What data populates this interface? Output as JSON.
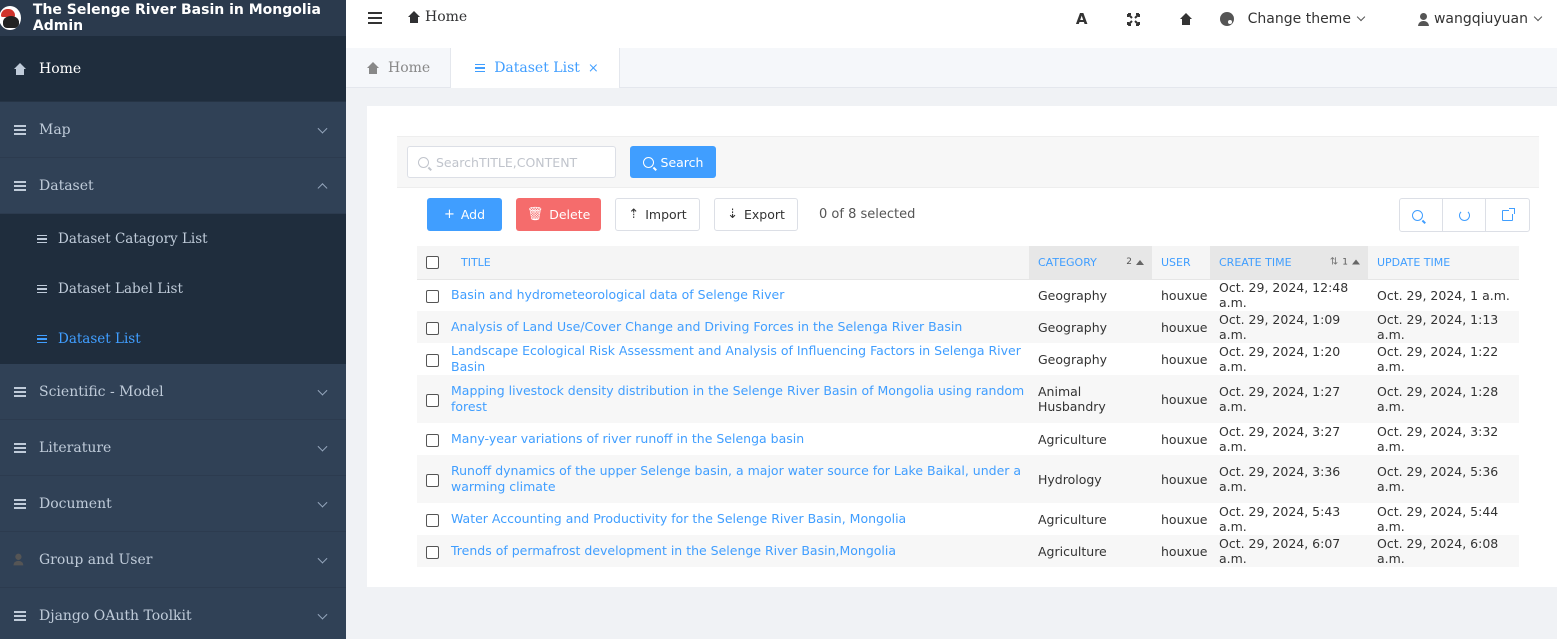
{
  "app": {
    "title": "The Selenge River Basin in Mongolia Admin"
  },
  "sidebar": {
    "items": [
      {
        "label": "Home"
      },
      {
        "label": "Map"
      },
      {
        "label": "Dataset"
      },
      {
        "label": "Scientific - Model"
      },
      {
        "label": "Literature"
      },
      {
        "label": "Document"
      },
      {
        "label": "Group and User"
      },
      {
        "label": "Django OAuth Toolkit"
      }
    ],
    "dataset_sub": [
      {
        "label": "Dataset Catagory List"
      },
      {
        "label": "Dataset Label List"
      },
      {
        "label": "Dataset List"
      }
    ]
  },
  "header": {
    "breadcrumb": "Home",
    "theme_label": "Change theme",
    "username": "wangqiuyuan",
    "font_glyph": "A"
  },
  "tabs": [
    {
      "label": "Home"
    },
    {
      "label": "Dataset List",
      "close": "×"
    }
  ],
  "search": {
    "placeholder": "SearchTITLE,CONTENT",
    "button": "Search"
  },
  "toolbar": {
    "add": "Add",
    "delete": "Delete",
    "import": "Import",
    "export": "Export",
    "selected": "0 of 8 selected"
  },
  "table": {
    "columns": [
      "TITLE",
      "CATEGORY",
      "USER",
      "CREATE TIME",
      "UPDATE TIME"
    ],
    "category_sort_rank": "2",
    "create_sort_rank": "1",
    "rows": [
      [
        "Basin and hydrometeorological data of Selenge River",
        "Geography",
        "houxue",
        "Oct. 29, 2024, 12:48 a.m.",
        "Oct. 29, 2024, 1 a.m."
      ],
      [
        "Analysis of Land Use/Cover Change and Driving Forces in the Selenga River Basin",
        "Geography",
        "houxue",
        "Oct. 29, 2024, 1:09 a.m.",
        "Oct. 29, 2024, 1:13 a.m."
      ],
      [
        "Landscape Ecological Risk Assessment and Analysis of Influencing Factors in Selenga River Basin",
        "Geography",
        "houxue",
        "Oct. 29, 2024, 1:20 a.m.",
        "Oct. 29, 2024, 1:22 a.m."
      ],
      [
        "Mapping livestock density distribution in the Selenge River Basin of Mongolia using random forest",
        "Animal Husbandry",
        "houxue",
        "Oct. 29, 2024, 1:27 a.m.",
        "Oct. 29, 2024, 1:28 a.m."
      ],
      [
        "Many-year variations of river runoff in the Selenga basin",
        "Agriculture",
        "houxue",
        "Oct. 29, 2024, 3:27 a.m.",
        "Oct. 29, 2024, 3:32 a.m."
      ],
      [
        "Runoff dynamics of the upper Selenge basin, a major water source for Lake Baikal, under a warming climate",
        "Hydrology",
        "houxue",
        "Oct. 29, 2024, 3:36 a.m.",
        "Oct. 29, 2024, 5:36 a.m."
      ],
      [
        "Water Accounting and Productivity for the Selenge River Basin, Mongolia",
        "Agriculture",
        "houxue",
        "Oct. 29, 2024, 5:43 a.m.",
        "Oct. 29, 2024, 5:44 a.m."
      ],
      [
        "Trends of permafrost development in the Selenge River Basin,Mongolia",
        "Agriculture",
        "houxue",
        "Oct. 29, 2024, 6:07 a.m.",
        "Oct. 29, 2024, 6:08 a.m."
      ]
    ]
  },
  "colors": {
    "primary": "#409eff",
    "danger": "#f56c6c",
    "sidebar": "#304156",
    "sidebar_active": "#1f2d3d"
  }
}
